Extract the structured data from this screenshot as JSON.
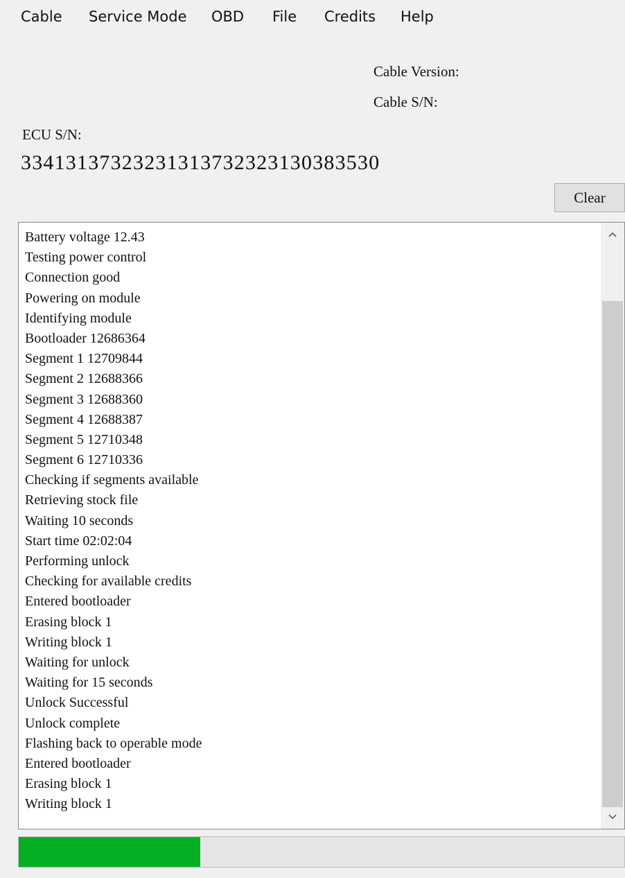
{
  "menu": {
    "cable": "Cable",
    "service_mode": "Service Mode",
    "obd": "OBD",
    "file": "File",
    "credits": "Credits",
    "help": "Help"
  },
  "info": {
    "cable_version_label": "Cable Version:",
    "cable_sn_label": "Cable S/N:",
    "ecu_sn_label": "ECU S/N:",
    "ecu_sn_value": "33413137323231313732323130383530"
  },
  "toolbar": {
    "clear_label": "Clear"
  },
  "log": {
    "lines": [
      "Battery voltage 12.43",
      "Testing power control",
      "Connection good",
      "Powering on module",
      "Identifying module",
      "Bootloader 12686364",
      "Segment 1 12709844",
      "Segment 2 12688366",
      "Segment 3 12688360",
      "Segment 4 12688387",
      "Segment 5 12710348",
      "Segment 6 12710336",
      "Checking if segments available",
      "Retrieving stock file",
      "Waiting 10 seconds",
      "Start time 02:02:04",
      "Performing unlock",
      "Checking for available credits",
      "Entered bootloader",
      "Erasing block 1",
      "Writing block 1",
      "Waiting for unlock",
      "Waiting for 15 seconds",
      "Unlock Successful",
      "Unlock complete",
      "Flashing back to operable mode",
      "Entered bootloader",
      "Erasing block 1",
      "Writing block 1"
    ]
  },
  "progress": {
    "fraction": 0.3,
    "fill_color": "#06b025"
  },
  "icons": {
    "scroll_up": "chevron-up-icon",
    "scroll_down": "chevron-down-icon"
  }
}
